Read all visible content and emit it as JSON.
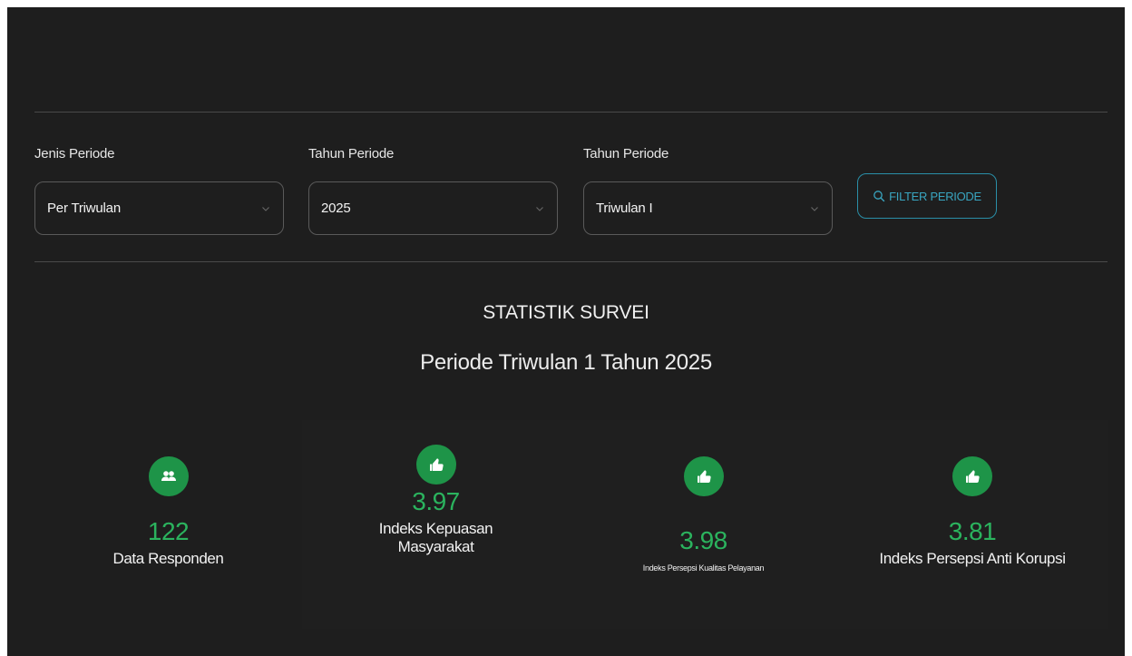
{
  "filters": {
    "jenis": {
      "label": "Jenis Periode",
      "value": "Per Triwulan"
    },
    "tahun": {
      "label": "Tahun Periode",
      "value": "2025"
    },
    "triwulan": {
      "label": "Tahun Periode",
      "value": "Triwulan I"
    },
    "button_label": "FILTER PERIODE"
  },
  "stats": {
    "title": "STATISTIK SURVEI",
    "subtitle": "Periode Triwulan 1 Tahun 2025",
    "cards": [
      {
        "value": "122",
        "label": "Data Responden",
        "icon": "users-icon"
      },
      {
        "value": "3.97",
        "label": "Indeks Kepuasan Masyarakat",
        "icon": "thumbs-up-icon"
      },
      {
        "value": "3.98",
        "label": "Indeks Persepsi Kualitas Pelayanan",
        "icon": "thumbs-up-icon"
      },
      {
        "value": "3.81",
        "label": "Indeks Persepsi Anti Korupsi",
        "icon": "thumbs-up-icon"
      }
    ]
  },
  "colors": {
    "background": "#1e1e1e",
    "accent_green": "#1e9448",
    "value_green": "#2bb35e",
    "button_teal": "#2a8fa8"
  }
}
